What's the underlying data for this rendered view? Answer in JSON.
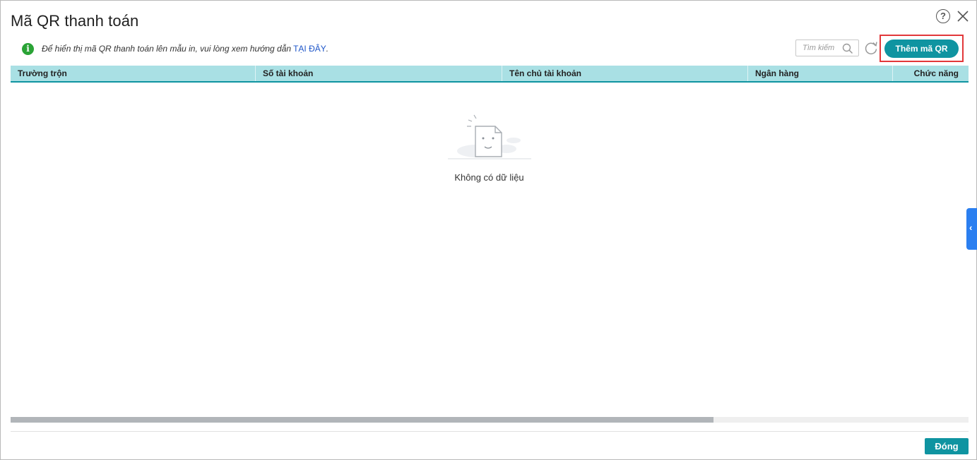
{
  "dialog": {
    "title": "Mã QR thanh toán",
    "help_icon": "question-mark-icon",
    "close_icon": "close-icon"
  },
  "notice": {
    "icon": "info-icon",
    "text": "Để hiển thị mã QR thanh toán lên mẫu in, vui lòng xem hướng dẫn",
    "link": "TẠI ĐÂY",
    "suffix": "."
  },
  "toolbar": {
    "search_placeholder": "Tìm kiếm",
    "search_value": "",
    "refresh_icon": "refresh-icon",
    "add_button": "Thêm mã QR"
  },
  "table": {
    "columns": [
      "Trường trộn",
      "Số tài khoản",
      "Tên chủ tài khoản",
      "Ngân hàng",
      "Chức năng"
    ],
    "rows": [],
    "empty_text": "Không có dữ liệu"
  },
  "footer": {
    "close_button": "Đóng"
  },
  "colors": {
    "accent": "#0f94a1",
    "header_bg": "#a9e0e4",
    "highlight": "#e2383a",
    "side_tab": "#2b7ff0",
    "info": "#2aa336"
  }
}
